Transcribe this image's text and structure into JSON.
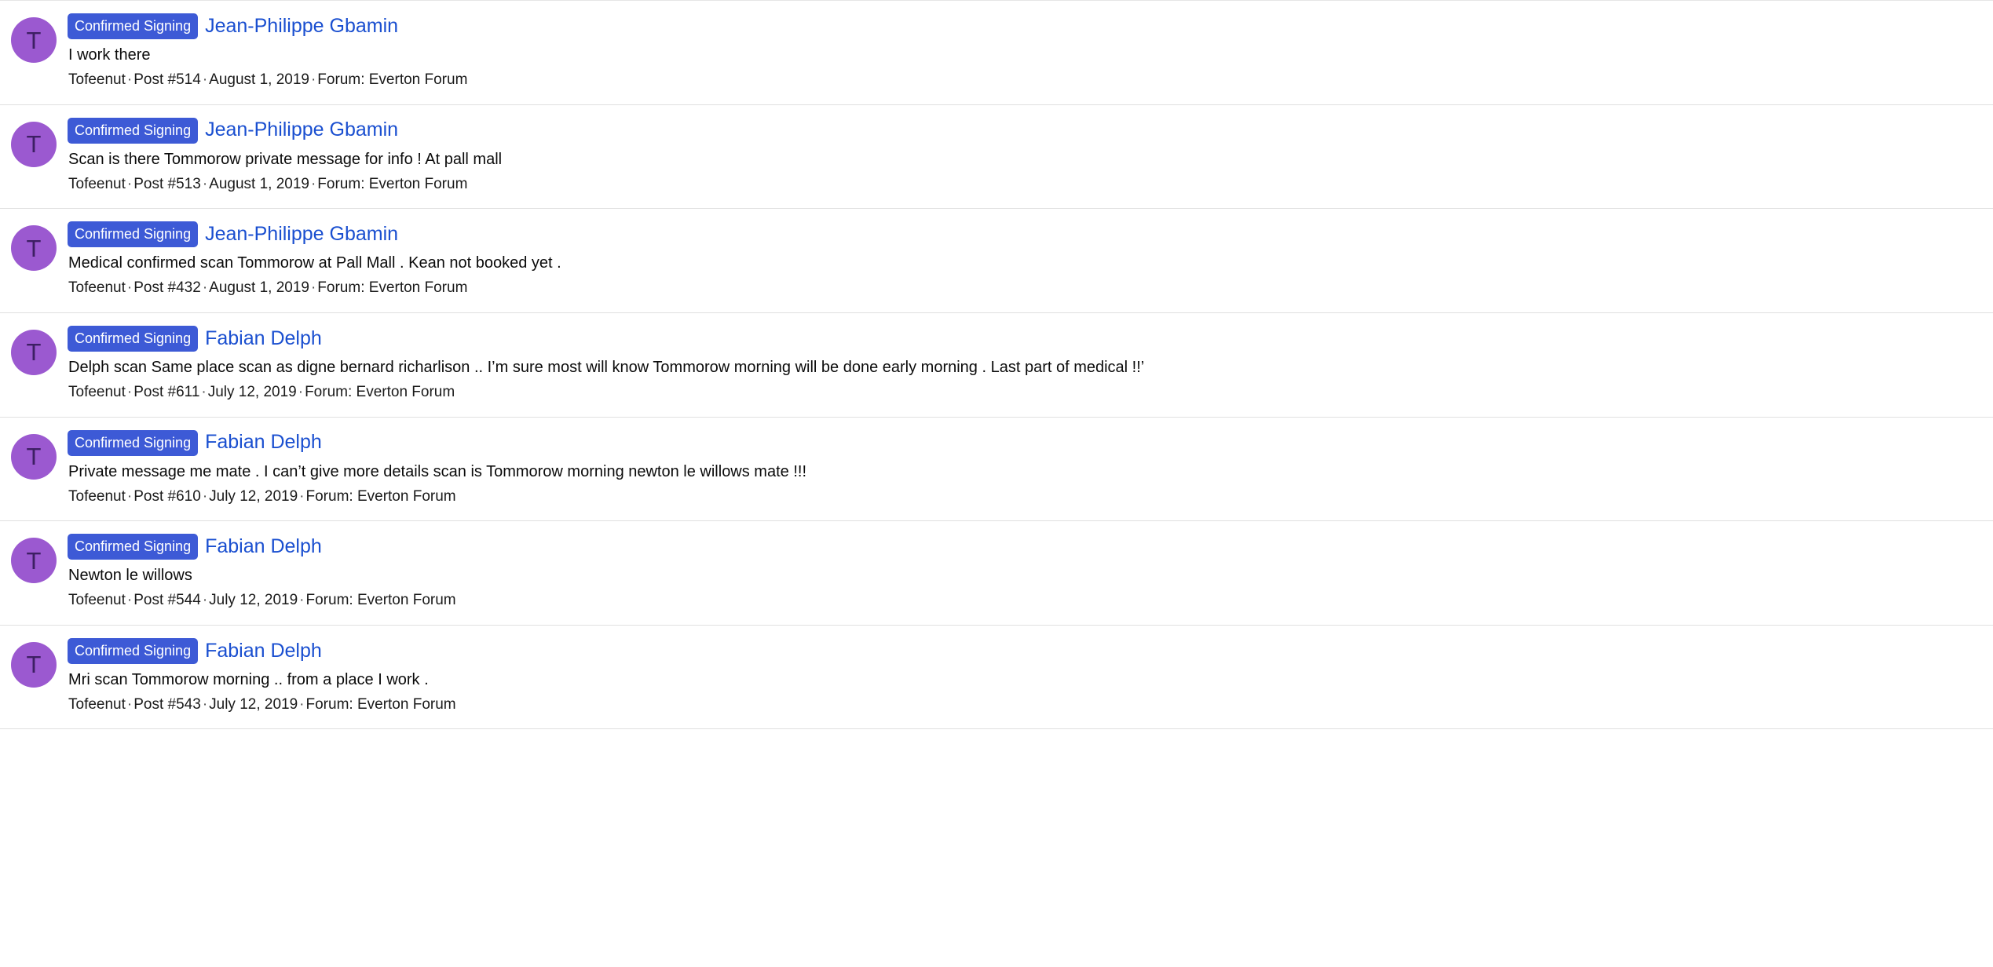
{
  "list": {
    "avatar_letter": "T",
    "avatar_color": "#9b59d0",
    "avatar_letter_color": "#3d1f63",
    "badge_color": "#3d5ad6",
    "link_color": "#1a4fd0",
    "separator": "·",
    "rows": [
      {
        "badge": "Confirmed Signing",
        "title": "Jean-Philippe Gbamin",
        "snippet": "I work there",
        "author": "Tofeenut",
        "post": "Post #514",
        "date": "August 1, 2019",
        "forum": "Forum: Everton Forum"
      },
      {
        "badge": "Confirmed Signing",
        "title": "Jean-Philippe Gbamin",
        "snippet": "Scan is there Tommorow private message for info ! At pall mall",
        "author": "Tofeenut",
        "post": "Post #513",
        "date": "August 1, 2019",
        "forum": "Forum: Everton Forum"
      },
      {
        "badge": "Confirmed Signing",
        "title": "Jean-Philippe Gbamin",
        "snippet": "Medical confirmed scan Tommorow at Pall Mall . Kean not booked yet .",
        "author": "Tofeenut",
        "post": "Post #432",
        "date": "August 1, 2019",
        "forum": "Forum: Everton Forum"
      },
      {
        "badge": "Confirmed Signing",
        "title": "Fabian Delph",
        "snippet": "Delph scan Same place scan as digne bernard richarlison .. I’m sure most will know Tommorow morning will be done early morning . Last part of medical !!’",
        "author": "Tofeenut",
        "post": "Post #611",
        "date": "July 12, 2019",
        "forum": "Forum: Everton Forum"
      },
      {
        "badge": "Confirmed Signing",
        "title": "Fabian Delph",
        "snippet": "Private message me mate . I can’t give more details scan is Tommorow morning newton le willows mate !!!",
        "author": "Tofeenut",
        "post": "Post #610",
        "date": "July 12, 2019",
        "forum": "Forum: Everton Forum"
      },
      {
        "badge": "Confirmed Signing",
        "title": "Fabian Delph",
        "snippet": "Newton le willows",
        "author": "Tofeenut",
        "post": "Post #544",
        "date": "July 12, 2019",
        "forum": "Forum: Everton Forum"
      },
      {
        "badge": "Confirmed Signing",
        "title": "Fabian Delph",
        "snippet": "Mri scan Tommorow morning .. from a place I work .",
        "author": "Tofeenut",
        "post": "Post #543",
        "date": "July 12, 2019",
        "forum": "Forum: Everton Forum"
      }
    ]
  }
}
